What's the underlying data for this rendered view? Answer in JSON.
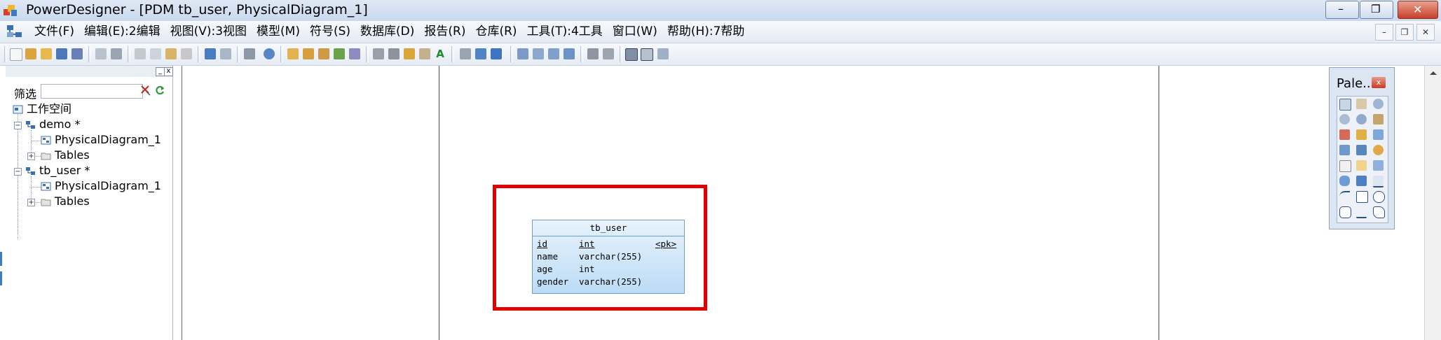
{
  "window": {
    "title": "PowerDesigner - [PDM tb_user, PhysicalDiagram_1]",
    "minimize": "–",
    "restore": "❐",
    "close": "✕"
  },
  "menu": {
    "items": [
      "文件(F)",
      "编辑(E):2编辑",
      "视图(V):3视图",
      "模型(M)",
      "符号(S)",
      "数据库(D)",
      "报告(R)",
      "仓库(R)",
      "工具(T):4工具",
      "窗口(W)",
      "帮助(H):7帮助"
    ],
    "mdi_minimize": "–",
    "mdi_restore": "❐",
    "mdi_close": "✕"
  },
  "browser": {
    "filter_label": "筛选",
    "filter_value": "",
    "tree": {
      "workspace": "工作空间",
      "model1": "demo *",
      "model1_diagram": "PhysicalDiagram_1",
      "model1_tables": "Tables",
      "model2": "tb_user *",
      "model2_diagram": "PhysicalDiagram_1",
      "model2_tables": "Tables"
    }
  },
  "diagram": {
    "table": {
      "name": "tb_user",
      "columns": [
        {
          "name": "id",
          "type": "int",
          "key": "<pk>"
        },
        {
          "name": "name",
          "type": "varchar(255)",
          "key": ""
        },
        {
          "name": "age",
          "type": "int",
          "key": ""
        },
        {
          "name": "gender",
          "type": "varchar(255)",
          "key": ""
        }
      ]
    }
  },
  "palette": {
    "title": "Pale...",
    "close": "x"
  },
  "colors": {
    "highlight": "#e00000",
    "table_fill": "#cfe6fa",
    "table_border": "#6f9ec4"
  }
}
